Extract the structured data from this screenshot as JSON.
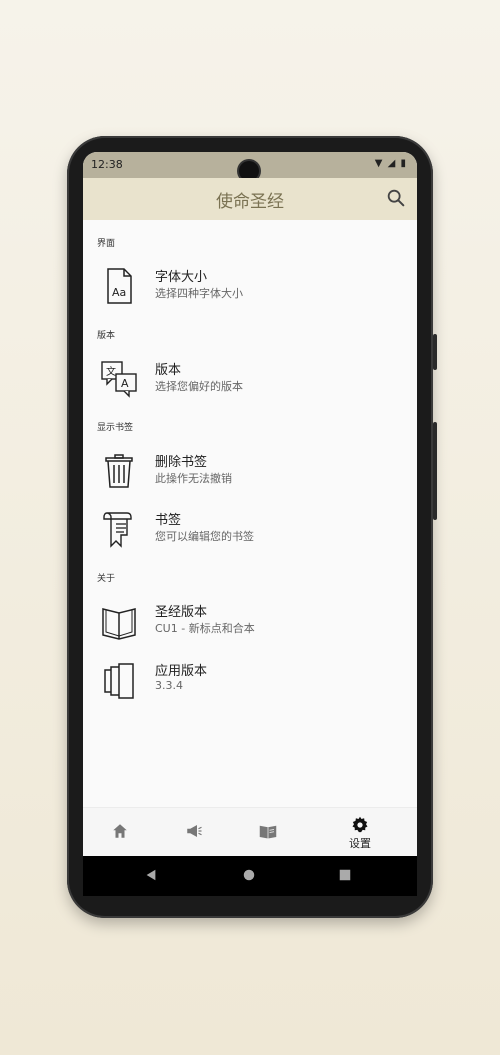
{
  "status": {
    "time": "12:38"
  },
  "appbar": {
    "title": "使命圣经",
    "search_icon": "search-icon"
  },
  "sections": [
    {
      "label": "界面",
      "items": [
        {
          "title": "字体大小",
          "subtitle": "选择四种字体大小",
          "icon": "font-size-icon"
        }
      ]
    },
    {
      "label": "版本",
      "items": [
        {
          "title": "版本",
          "subtitle": "选择您偏好的版本",
          "icon": "translate-icon"
        }
      ]
    },
    {
      "label": "显示书签",
      "items": [
        {
          "title": "删除书签",
          "subtitle": "此操作无法撤销",
          "icon": "trash-icon"
        },
        {
          "title": "书签",
          "subtitle": "您可以编辑您的书签",
          "icon": "bookmark-scroll-icon"
        }
      ]
    },
    {
      "label": "关于",
      "items": [
        {
          "title": "圣经版本",
          "subtitle": "CU1 - 新标点和合本",
          "icon": "open-book-icon"
        },
        {
          "title": "应用版本",
          "subtitle": "3.3.4",
          "icon": "layers-icon"
        }
      ]
    }
  ],
  "bottom_nav": {
    "items": [
      {
        "icon": "home-icon",
        "label": ""
      },
      {
        "icon": "megaphone-icon",
        "label": ""
      },
      {
        "icon": "book-icon",
        "label": ""
      },
      {
        "icon": "gear-icon",
        "label": "设置"
      }
    ]
  },
  "colors": {
    "appbar_bg": "#e9e3cd",
    "title": "#7a7252",
    "statusbar_bg": "#b7b19c"
  }
}
